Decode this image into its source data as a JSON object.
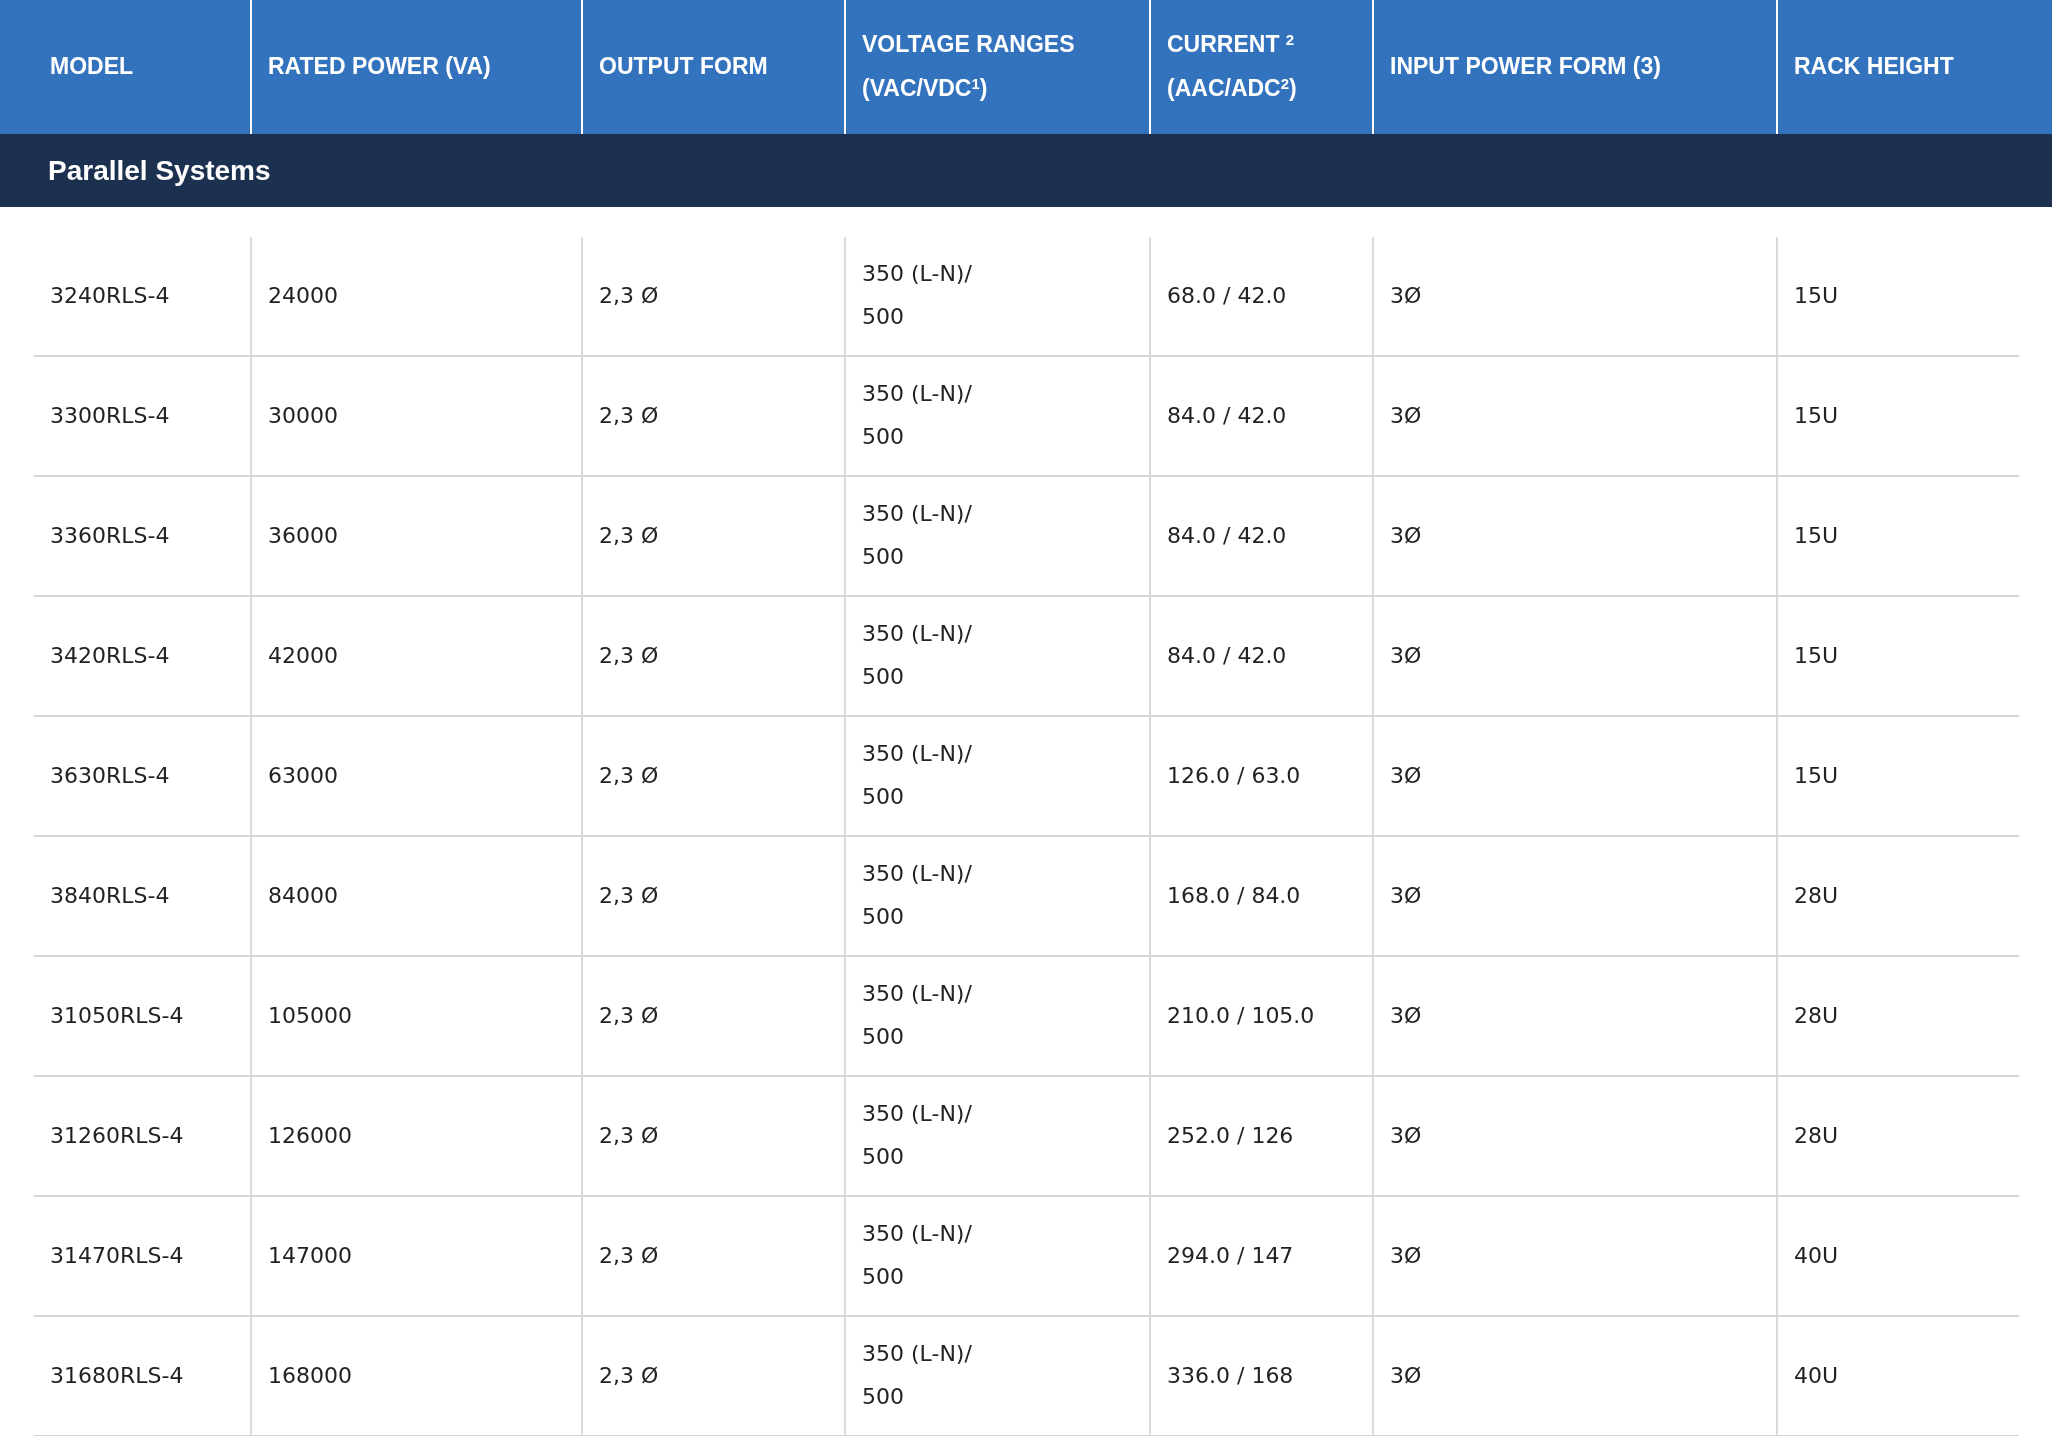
{
  "table": {
    "columns": [
      "MODEL",
      "RATED POWER (VA)",
      "OUTPUT FORM",
      "VOLTAGE RANGES (VAC/VDC$^{1}$)",
      "CURRENT $^{2}$ (AAC/ADC$^{2}$)",
      "INPUT POWER FORM (3)",
      "RACK HEIGHT"
    ],
    "sections": [
      {
        "title": "Parallel Systems",
        "rows": [
          [
            "3240RLS-4",
            "24000",
            "2,3 Ø",
            "350 (L-N)/ 500",
            "68.0 / 42.0",
            "3Ø",
            "15U"
          ],
          [
            "3300RLS-4",
            "30000",
            "2,3 Ø",
            "350 (L-N)/ 500",
            "84.0 / 42.0",
            "3Ø",
            "15U"
          ],
          [
            "3360RLS-4",
            "36000",
            "2,3 Ø",
            "350 (L-N)/ 500",
            "84.0 / 42.0",
            "3Ø",
            "15U"
          ],
          [
            "3420RLS-4",
            "42000",
            "2,3 Ø",
            "350 (L-N)/ 500",
            "84.0 / 42.0",
            "3Ø",
            "15U"
          ],
          [
            "3630RLS-4",
            "63000",
            "2,3 Ø",
            "350 (L-N)/ 500",
            "126.0 / 63.0",
            "3Ø",
            "15U"
          ],
          [
            "3840RLS-4",
            "84000",
            "2,3 Ø",
            "350 (L-N)/ 500",
            "168.0 / 84.0",
            "3Ø",
            "28U"
          ],
          [
            "31050RLS-4",
            "105000",
            "2,3 Ø",
            "350 (L-N)/ 500",
            "210.0 / 105.0",
            "3Ø",
            "28U"
          ],
          [
            "31260RLS-4",
            "126000",
            "2,3 Ø",
            "350 (L-N)/ 500",
            "252.0 / 126",
            "3Ø",
            "28U"
          ],
          [
            "31470RLS-4",
            "147000",
            "2,3 Ø",
            "350 (L-N)/ 500",
            "294.0 / 147",
            "3Ø",
            "40U"
          ],
          [
            "31680RLS-4",
            "168000",
            "2,3 Ø",
            "350 (L-N)/ 500",
            "336.0 / 168",
            "3Ø",
            "40U"
          ]
        ]
      }
    ]
  }
}
